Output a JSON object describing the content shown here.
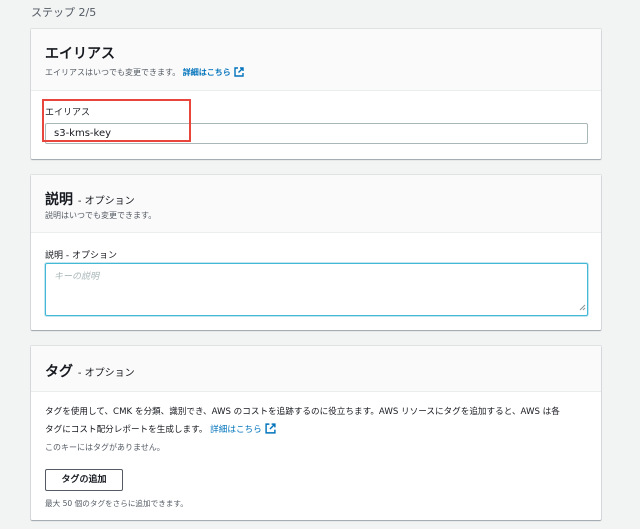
{
  "step_indicator": "ステップ 2/5",
  "alias_panel": {
    "title": "エイリアス",
    "description": "エイリアスはいつでも変更できます。",
    "learn_more": "詳細はこちら",
    "field_label": "エイリアス",
    "field_value": "s3-kms-key"
  },
  "description_panel": {
    "title": "説明",
    "optional": "- オプション",
    "description": "説明はいつでも変更できます。",
    "field_label": "説明 - オプション",
    "placeholder": "キーの説明"
  },
  "tags_panel": {
    "title": "タグ",
    "optional": "- オプション",
    "body_text": "タグを使用して、CMK を分類、識別でき、AWS のコストを追跡するのに役立ちます。AWS リソースにタグを追加すると、AWS は各",
    "body_text_2": "タグにコスト配分レポートを生成します。",
    "learn_more": "詳細はこちら",
    "empty_text": "このキーにはタグがありません。",
    "add_button": "タグの追加",
    "limit_text": "最大 50 個のタグをさらに追加できます。"
  },
  "colors": {
    "link": "#0073bb",
    "highlight": "#e8453c",
    "focus": "#44b9d6"
  }
}
